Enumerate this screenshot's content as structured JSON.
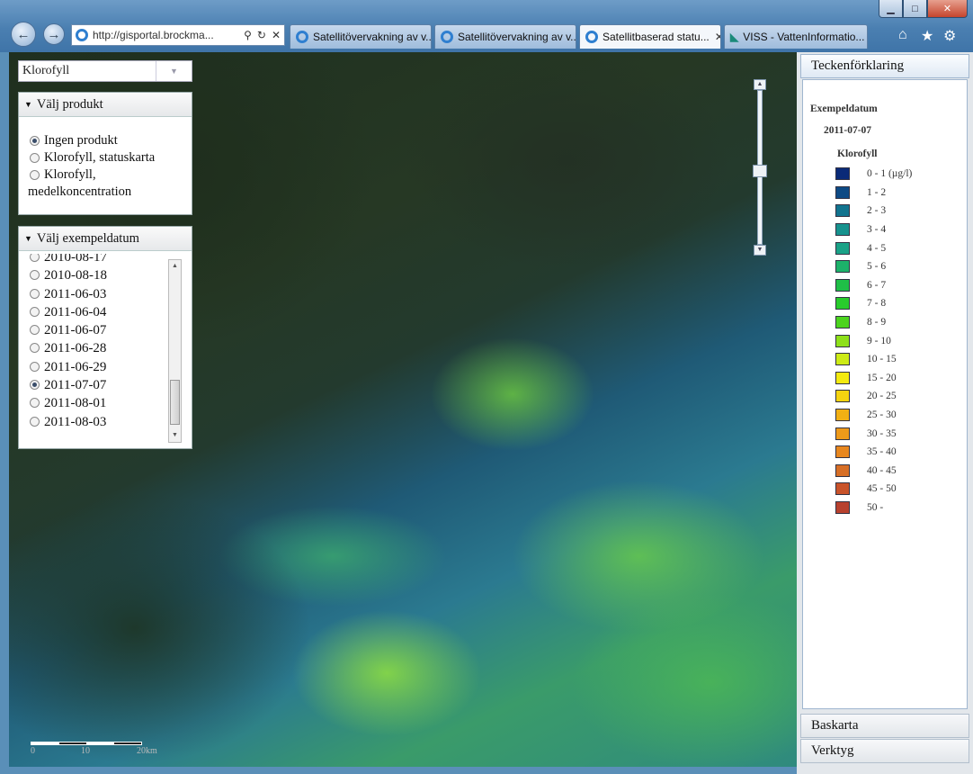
{
  "browser": {
    "address": "http://gisportal.brockma...",
    "tabs": [
      {
        "label": "Satellitövervakning av v..."
      },
      {
        "label": "Satellitövervakning av v..."
      },
      {
        "label": "Satellitbaserad statu..."
      },
      {
        "label": "VISS - VattenInformatio..."
      }
    ],
    "icons": [
      "back-icon",
      "forward-icon",
      "home-icon",
      "favorites-icon",
      "tools-icon"
    ]
  },
  "layer_select": {
    "value": "Klorofyll"
  },
  "product_panel": {
    "title": "Välj produkt",
    "options": [
      "Ingen produkt",
      "Klorofyll, statuskarta",
      "Klorofyll,",
      "medelkoncentration"
    ],
    "selected": "Ingen produkt"
  },
  "date_panel": {
    "title": "Välj exempeldatum",
    "dates": [
      "2010-08-17",
      "2010-08-18",
      "2011-06-03",
      "2011-06-04",
      "2011-06-07",
      "2011-06-28",
      "2011-06-29",
      "2011-07-07",
      "2011-08-01",
      "2011-08-03"
    ],
    "selected": "2011-07-07"
  },
  "scale": {
    "labels": [
      "0",
      "10",
      "20km"
    ]
  },
  "legend": {
    "header": "Teckenförklaring",
    "title": "Exempeldatum",
    "date": "2011-07-07",
    "variable": "Klorofyll",
    "items": [
      {
        "label": "0 - 1 (µg/l)",
        "color": "#0a2a78"
      },
      {
        "label": "1 - 2",
        "color": "#0d4a85"
      },
      {
        "label": "2 - 3",
        "color": "#11748f"
      },
      {
        "label": "3 - 4",
        "color": "#16928e"
      },
      {
        "label": "4 - 5",
        "color": "#1aa287"
      },
      {
        "label": "5 - 6",
        "color": "#1db26a"
      },
      {
        "label": "6 - 7",
        "color": "#1fbf47"
      },
      {
        "label": "7 - 8",
        "color": "#28cc2c"
      },
      {
        "label": "8 - 9",
        "color": "#4cd41e"
      },
      {
        "label": "9 - 10",
        "color": "#8ee01a"
      },
      {
        "label": "10 - 15",
        "color": "#cdeb16"
      },
      {
        "label": "15 - 20",
        "color": "#f3ea10"
      },
      {
        "label": "20 - 25",
        "color": "#f5d410"
      },
      {
        "label": "25 - 30",
        "color": "#f2b014"
      },
      {
        "label": "30 - 35",
        "color": "#ee9a1a"
      },
      {
        "label": "35 - 40",
        "color": "#e7871f"
      },
      {
        "label": "40 - 45",
        "color": "#d76f26"
      },
      {
        "label": "45 - 50",
        "color": "#c9532a"
      },
      {
        "label": "50 -",
        "color": "#b8412e"
      }
    ]
  },
  "accordion": {
    "basemap": "Baskarta",
    "tools": "Verktyg"
  }
}
